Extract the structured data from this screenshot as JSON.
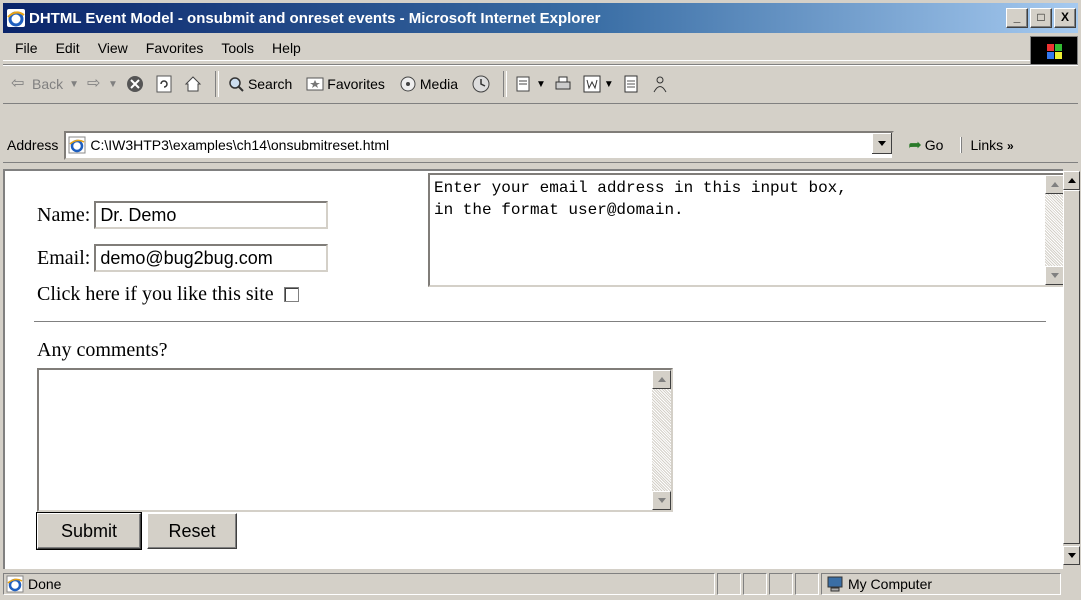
{
  "window": {
    "title": "DHTML Event Model - onsubmit and onreset events - Microsoft Internet Explorer",
    "controls": {
      "minimize": "_",
      "maximize": "□",
      "close": "X"
    }
  },
  "menu": [
    "File",
    "Edit",
    "View",
    "Favorites",
    "Tools",
    "Help"
  ],
  "toolbar": {
    "back": "Back",
    "search": "Search",
    "favorites": "Favorites",
    "media": "Media"
  },
  "address": {
    "label": "Address",
    "url": "C:\\IW3HTP3\\examples\\ch14\\onsubmitreset.html",
    "go": "Go",
    "links": "Links"
  },
  "form": {
    "name_label": "Name:",
    "name_value": "Dr. Demo",
    "email_label": "Email:",
    "email_value": "demo@bug2bug.com",
    "checkbox_label": "Click here if you like this site",
    "help_text": "Enter your email address in this input box,\nin the format user@domain.",
    "comments_label": "Any comments?",
    "comments_value": "",
    "submit_label": "Submit",
    "reset_label": "Reset"
  },
  "status": {
    "text": "Done",
    "zone": "My Computer"
  },
  "colors": {
    "titlebar_start": "#0a246a",
    "titlebar_end": "#a6caf0",
    "chrome": "#d4d0c8"
  }
}
